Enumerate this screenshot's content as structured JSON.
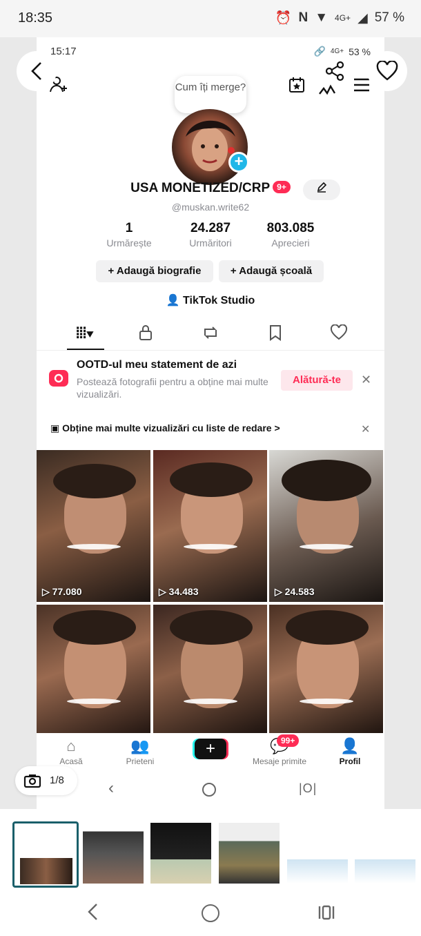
{
  "status_bar": {
    "time": "18:35",
    "battery": "57 %",
    "network": "4G+"
  },
  "inner_status": {
    "time": "15:17",
    "battery": "53 %",
    "network": "4G+"
  },
  "profile": {
    "bubble": "Cum îți merge?",
    "username": "USA MONETIZED/CRP",
    "badge": "9+",
    "handle": "@muskan.write62",
    "stats": [
      {
        "value": "1",
        "label": "Urmărește"
      },
      {
        "value": "24.287",
        "label": "Urmăritori"
      },
      {
        "value": "803.085",
        "label": "Aprecieri"
      }
    ],
    "buttons": {
      "bio": "+ Adaugă biografie",
      "school": "+ Adaugă școală"
    },
    "studio": "TikTok Studio"
  },
  "promo": {
    "title": "OOTD-ul meu statement de azi",
    "subtitle": "Postează fotografii pentru a obține mai multe vizualizări.",
    "button": "Alătură-te",
    "playlist": "Obține mai multe vizualizări cu liste de redare >"
  },
  "videos": [
    {
      "views": "77.080"
    },
    {
      "views": "34.483"
    },
    {
      "views": "24.583"
    },
    {
      "views": ""
    },
    {
      "views": ""
    },
    {
      "views": ""
    }
  ],
  "bottom_nav": {
    "home": "Acasă",
    "friends": "Prieteni",
    "inbox": "Mesaje primite",
    "inbox_badge": "99+",
    "profile": "Profil"
  },
  "viewer": {
    "counter": "1/8"
  },
  "colors": {
    "accent": "#fe2c55",
    "cyan": "#20b7e8"
  }
}
